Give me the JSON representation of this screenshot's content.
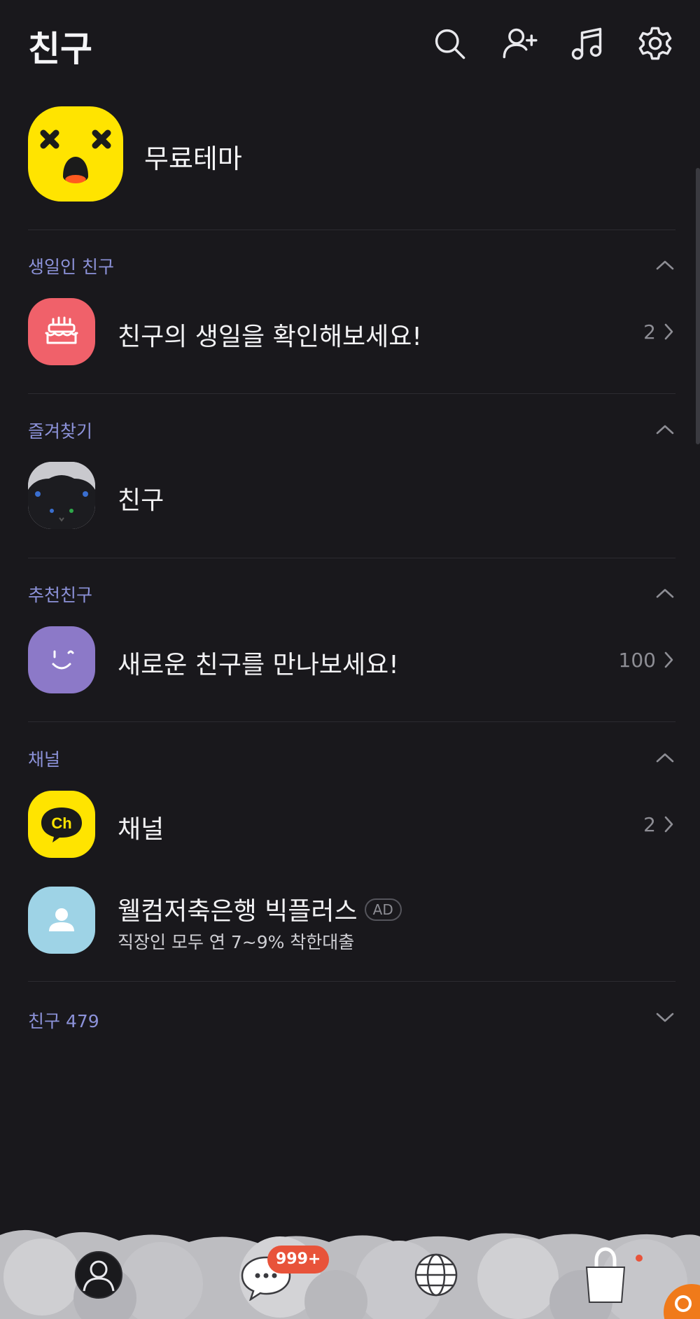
{
  "header": {
    "title": "친구",
    "icons": [
      "search-icon",
      "add-friend-icon",
      "music-icon",
      "settings-icon"
    ]
  },
  "profile": {
    "name": "무료테마"
  },
  "sections": {
    "birthday": {
      "label": "생일인 친구",
      "row_label": "친구의 생일을 확인해보세요!",
      "count": "2"
    },
    "favorites": {
      "label": "즐겨찾기",
      "row_label": "친구"
    },
    "recommended": {
      "label": "추천친구",
      "row_label": "새로운 친구를 만나보세요!",
      "count": "100"
    },
    "channel": {
      "label": "채널",
      "row_label": "채널",
      "count": "2",
      "ad_title": "웰컴저축은행 빅플러스",
      "ad_badge": "AD",
      "ad_subtitle": "직장인 모두 연 7~9% 착한대출"
    }
  },
  "friends_count": {
    "label": "친구 479"
  },
  "bottom_nav": {
    "chat_badge": "999+",
    "icons": [
      "friends-tab-icon",
      "chat-tab-icon",
      "openchat-tab-icon",
      "shopping-tab-icon"
    ]
  },
  "colors": {
    "background": "#19181c",
    "section_label": "#8c92d9",
    "badge": "#e8533a",
    "kakao_yellow": "#ffe400"
  }
}
